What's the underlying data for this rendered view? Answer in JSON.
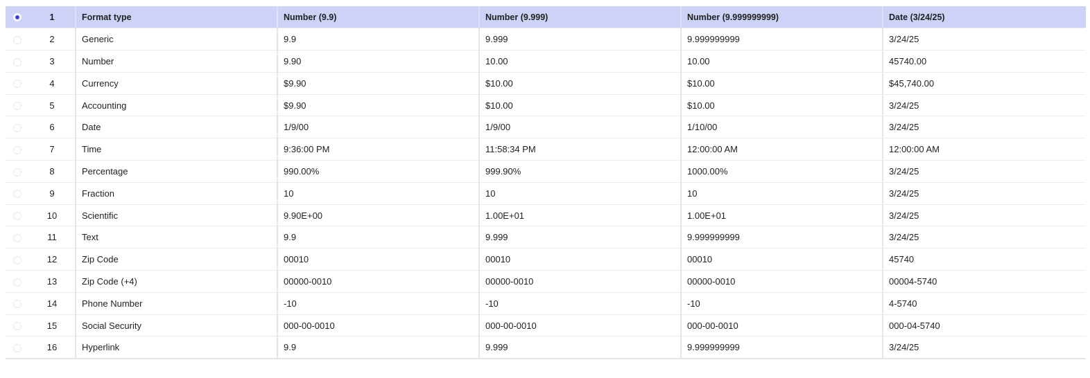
{
  "selected_row": 0,
  "rows": [
    {
      "num": "1",
      "cells": [
        "Format type",
        "Number (9.9)",
        "Number (9.999)",
        "Number (9.999999999)",
        "Date (3/24/25)"
      ]
    },
    {
      "num": "2",
      "cells": [
        "Generic",
        "9.9",
        "9.999",
        "9.999999999",
        "3/24/25"
      ]
    },
    {
      "num": "3",
      "cells": [
        "Number",
        "9.90",
        "10.00",
        "10.00",
        "45740.00"
      ]
    },
    {
      "num": "4",
      "cells": [
        "Currency",
        "$9.90",
        "$10.00",
        "$10.00",
        "$45,740.00"
      ]
    },
    {
      "num": "5",
      "cells": [
        "Accounting",
        "$9.90",
        "$10.00",
        "$10.00",
        "3/24/25"
      ]
    },
    {
      "num": "6",
      "cells": [
        "Date",
        "1/9/00",
        "1/9/00",
        "1/10/00",
        "3/24/25"
      ]
    },
    {
      "num": "7",
      "cells": [
        "Time",
        "9:36:00 PM",
        "11:58:34 PM",
        "12:00:00 AM",
        "12:00:00 AM"
      ]
    },
    {
      "num": "8",
      "cells": [
        "Percentage",
        "990.00%",
        "999.90%",
        "1000.00%",
        "3/24/25"
      ]
    },
    {
      "num": "9",
      "cells": [
        "Fraction",
        "10",
        "10",
        "10",
        "3/24/25"
      ]
    },
    {
      "num": "10",
      "cells": [
        "Scientific",
        "9.90E+00",
        "1.00E+01",
        "1.00E+01",
        "3/24/25"
      ]
    },
    {
      "num": "11",
      "cells": [
        "Text",
        "9.9",
        "9.999",
        "9.999999999",
        "3/24/25"
      ]
    },
    {
      "num": "12",
      "cells": [
        "Zip Code",
        "00010",
        "00010",
        "00010",
        "45740"
      ]
    },
    {
      "num": "13",
      "cells": [
        "Zip Code (+4)",
        "00000-0010",
        "00000-0010",
        "00000-0010",
        "00004-5740"
      ]
    },
    {
      "num": "14",
      "cells": [
        "Phone Number",
        "-10",
        "-10",
        "-10",
        "4-5740"
      ]
    },
    {
      "num": "15",
      "cells": [
        "Social Security",
        "000-00-0010",
        "000-00-0010",
        "000-00-0010",
        "000-04-5740"
      ]
    },
    {
      "num": "16",
      "cells": [
        "Hyperlink",
        "9.9",
        "9.999",
        "9.999999999",
        "3/24/25"
      ]
    }
  ]
}
